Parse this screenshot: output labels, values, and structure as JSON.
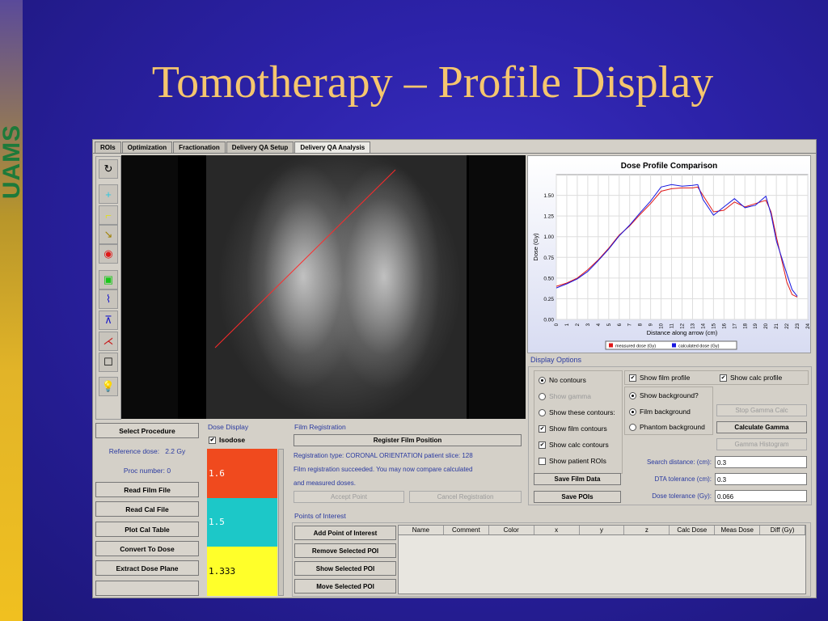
{
  "slide": {
    "title": "Tomotherapy – Profile Display",
    "logo_text": "UAMS"
  },
  "app": {
    "tabs": [
      {
        "label": "ROIs"
      },
      {
        "label": "Optimization"
      },
      {
        "label": "Fractionation"
      },
      {
        "label": "Delivery QA Setup"
      },
      {
        "label": "Delivery QA Analysis",
        "active": true
      }
    ],
    "toolbar": [
      "rotate-tool-icon",
      "crosshair-tool-icon",
      "corner-tool-icon",
      "arrow-tool-icon",
      "roi-tool-icon",
      "square-tool-icon",
      "profile-horizontal-icon",
      "profile-vertical-icon",
      "profile-diagonal-icon",
      "box-tool-icon",
      "light-icon"
    ],
    "left_buttons": {
      "select_procedure": "Select Procedure",
      "read_film_file": "Read Film File",
      "read_cal_file": "Read Cal File",
      "plot_cal_table": "Plot Cal Table",
      "convert_to_dose": "Convert To Dose",
      "extract_dose_plane": "Extract Dose Plane"
    },
    "info": {
      "reference_dose_label": "Reference dose:",
      "reference_dose_value": "2.2 Gy",
      "proc_number_label": "Proc number:",
      "proc_number_value": "0"
    },
    "dose_display": {
      "title": "Dose Display",
      "isodose_label": "Isodose",
      "bands": [
        {
          "value": "1.6",
          "color": "#f04a1e"
        },
        {
          "value": "1.5",
          "color": "#1cc8c8"
        },
        {
          "value": "1.333",
          "color": "#ffff2a"
        }
      ]
    },
    "film_registration": {
      "title": "Film Registration",
      "register_button": "Register Film Position",
      "line1": "Registration type: CORONAL ORIENTATION patient slice: 128",
      "line2": "Film registration succeeded. You may now compare calculated",
      "line3": "and measured doses.",
      "accept_point": "Accept Point",
      "cancel_registration": "Cancel Registration"
    },
    "display_options": {
      "title": "Display Options",
      "no_contours": "No contours",
      "show_gamma": "Show gamma",
      "show_these_contours": "Show these contours:",
      "show_film_contours": "Show film contours",
      "show_calc_contours": "Show calc contours",
      "show_patient_rois": "Show patient ROIs",
      "show_film_profile": "Show film profile",
      "show_calc_profile": "Show calc profile",
      "show_background": "Show background?",
      "film_background": "Film background",
      "phantom_background": "Phantom background",
      "stop_gamma_calc": "Stop Gamma Calc",
      "calculate_gamma": "Calculate Gamma",
      "gamma_histogram": "Gamma Histogram",
      "save_film_data": "Save Film Data",
      "save_pois": "Save POIs",
      "search_distance_label": "Search distance: (cm):",
      "search_distance_value": "0.3",
      "dta_tolerance_label": "DTA tolerance (cm):",
      "dta_tolerance_value": "0.3",
      "dose_tolerance_label": "Dose tolerance (Gy):",
      "dose_tolerance_value": "0.066"
    },
    "poi": {
      "title": "Points of Interest",
      "add": "Add Point of Interest",
      "remove": "Remove Selected POI",
      "show": "Show Selected POI",
      "move": "Move Selected POI",
      "columns": [
        "Name",
        "Comment",
        "Color",
        "x",
        "y",
        "z",
        "Calc Dose",
        "Meas Dose",
        "Diff (Gy)"
      ]
    }
  },
  "chart_data": {
    "type": "line",
    "title": "Dose Profile Comparison",
    "xlabel": "Distance along arrow (cm)",
    "ylabel": "Dose (Gy)",
    "xlim": [
      0,
      24
    ],
    "ylim": [
      0,
      1.75
    ],
    "yticks": [
      0.0,
      0.25,
      0.5,
      0.75,
      1.0,
      1.25,
      1.5
    ],
    "ytick_labels": [
      "0.00",
      "0.25",
      "0.50",
      "0.75",
      "1.00",
      "1.25",
      "1.50"
    ],
    "xticks": [
      0,
      1,
      2,
      3,
      4,
      5,
      6,
      7,
      8,
      9,
      10,
      11,
      12,
      13,
      14,
      15,
      16,
      17,
      18,
      19,
      20,
      21,
      22,
      23,
      24
    ],
    "grid": true,
    "legend_position": "bottom",
    "series": [
      {
        "name": "measured dose (Gy)",
        "color": "#e01818",
        "x": [
          0,
          1,
          2,
          3,
          4,
          5,
          6,
          7,
          8,
          9,
          10,
          11,
          12,
          13,
          13.5,
          14,
          15,
          16,
          17,
          18,
          19,
          20,
          20.5,
          21,
          22,
          22.5,
          23
        ],
        "y": [
          0.4,
          0.44,
          0.5,
          0.6,
          0.72,
          0.86,
          1.02,
          1.13,
          1.27,
          1.4,
          1.55,
          1.58,
          1.59,
          1.59,
          1.6,
          1.5,
          1.3,
          1.32,
          1.42,
          1.36,
          1.4,
          1.44,
          1.3,
          1.0,
          0.45,
          0.3,
          0.27
        ]
      },
      {
        "name": "calculated dose (Gy)",
        "color": "#1818e0",
        "x": [
          0,
          1,
          2,
          3,
          4,
          5,
          6,
          7,
          8,
          9,
          10,
          11,
          12,
          13,
          13.5,
          14,
          15,
          16,
          17,
          18,
          19,
          20,
          20.5,
          21,
          22,
          22.5,
          23
        ],
        "y": [
          0.38,
          0.43,
          0.49,
          0.58,
          0.71,
          0.85,
          1.01,
          1.14,
          1.29,
          1.43,
          1.6,
          1.63,
          1.61,
          1.62,
          1.63,
          1.45,
          1.26,
          1.36,
          1.46,
          1.35,
          1.38,
          1.49,
          1.27,
          0.95,
          0.55,
          0.36,
          0.28
        ]
      }
    ]
  }
}
